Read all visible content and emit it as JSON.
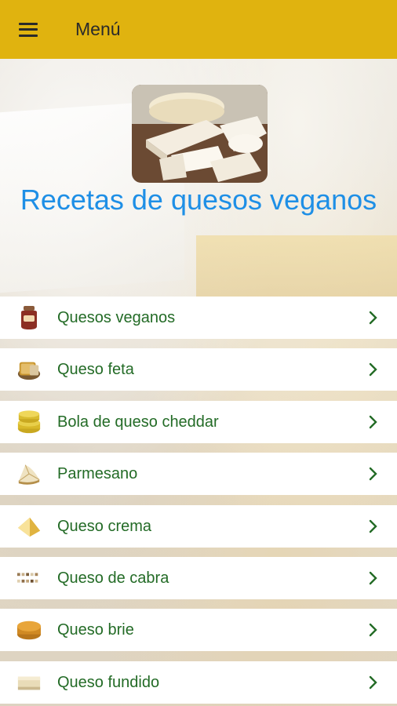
{
  "appbar": {
    "title": "Menú",
    "menu_icon": "hamburger-icon",
    "color": "#e0b30f"
  },
  "hero": {
    "title": "Recetas de quesos veganos",
    "title_color": "#1e8fe6",
    "image": "cheese-platter-image"
  },
  "menu": {
    "text_color": "#236b26",
    "chevron_icon": "chevron-right-icon",
    "items": [
      {
        "label": "Quesos veganos",
        "icon": "cheese-jar-icon"
      },
      {
        "label": "Queso feta",
        "icon": "feta-block-icon"
      },
      {
        "label": "Bola de queso cheddar",
        "icon": "cheddar-wheels-icon"
      },
      {
        "label": "Parmesano",
        "icon": "parmesan-wedge-icon"
      },
      {
        "label": "Queso crema",
        "icon": "cream-cheese-wedge-icon"
      },
      {
        "label": "Queso de cabra",
        "icon": "goat-cheese-icon"
      },
      {
        "label": "Queso brie",
        "icon": "brie-wheel-icon"
      },
      {
        "label": "Queso fundido",
        "icon": "melted-cheese-icon"
      }
    ]
  }
}
